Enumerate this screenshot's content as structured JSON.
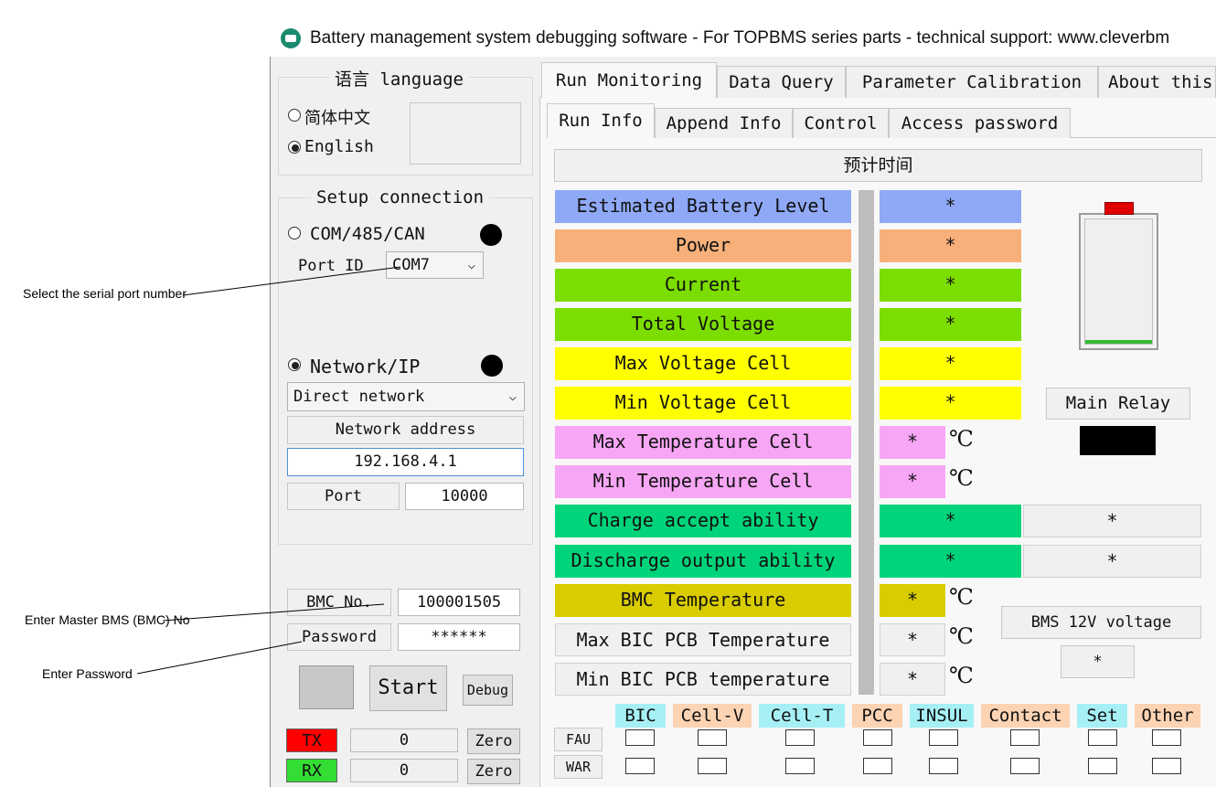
{
  "window": {
    "title": "Battery management system debugging software - For TOPBMS series parts - technical support: www.cleverbm"
  },
  "annotations": {
    "serial_port": "Select the serial port number",
    "master_bms": "Enter Master BMS (BMC) No",
    "password": "Enter Password"
  },
  "language": {
    "group_title": "语言 language",
    "option_cn": "简体中文",
    "option_en": "English"
  },
  "connection": {
    "group_title": "Setup connection",
    "com_label": "COM/485/CAN",
    "port_id_label": "Port ID",
    "port_id_value": "COM7",
    "network_label": "Network/IP",
    "network_type": "Direct network",
    "network_address_label": "Network address",
    "network_address_value": "192.168.4.1",
    "port_label": "Port",
    "port_value": "10000"
  },
  "login": {
    "bmc_label": "BMC No.",
    "bmc_value": "100001505",
    "password_label": "Password",
    "password_value": "******",
    "start": "Start",
    "debug": "Debug"
  },
  "traffic": {
    "tx_label": "TX",
    "tx_value": "0",
    "tx_zero": "Zero",
    "rx_label": "RX",
    "rx_value": "0",
    "rx_zero": "Zero"
  },
  "main_tabs": [
    "Run Monitoring",
    "Data Query",
    "Parameter Calibration",
    "About this"
  ],
  "sub_tabs": [
    "Run Info",
    "Append Info",
    "Control",
    "Access password"
  ],
  "estimated_time_label": "预计时间",
  "metrics": [
    {
      "label": "Estimated Battery Level",
      "value": "*",
      "unit": ""
    },
    {
      "label": "Power",
      "value": "*",
      "unit": ""
    },
    {
      "label": "Current",
      "value": "*",
      "unit": ""
    },
    {
      "label": "Total Voltage",
      "value": "*",
      "unit": ""
    },
    {
      "label": "Max Voltage Cell",
      "value": "*",
      "unit": ""
    },
    {
      "label": "Min Voltage Cell",
      "value": "*",
      "unit": ""
    },
    {
      "label": "Max Temperature Cell",
      "value": "*",
      "unit": "℃"
    },
    {
      "label": "Min Temperature Cell",
      "value": "*",
      "unit": "℃"
    },
    {
      "label": "Charge accept ability",
      "value": "*",
      "extra": "*"
    },
    {
      "label": "Discharge output ability",
      "value": "*",
      "extra": "*"
    },
    {
      "label": "BMC Temperature",
      "value": "*",
      "unit": "℃"
    },
    {
      "label": "Max BIC PCB Temperature",
      "value": "*",
      "unit": "℃"
    },
    {
      "label": "Min BIC PCB temperature",
      "value": "*",
      "unit": "℃"
    }
  ],
  "colors": {
    "battery": "#8fa9f7",
    "power": "#f8b07a",
    "green": "#7cdd00",
    "yellow": "#ffff00",
    "pink": "#f7a6f5",
    "teal": "#00d47a",
    "olive": "#d9cc00",
    "gray": "#f0f0f0",
    "tx": "#ff0000",
    "rx": "#33dd33"
  },
  "battery_indicator": {
    "level": 0.0
  },
  "main_relay": {
    "label": "Main Relay",
    "state": "off"
  },
  "bms12v": {
    "label": "BMS 12V voltage",
    "value": "*"
  },
  "alarm": {
    "categories": [
      "BIC",
      "Cell-V",
      "Cell-T",
      "PCC",
      "INSUL",
      "Contact",
      "Set",
      "Other"
    ],
    "category_colors": [
      "#a6f0f5",
      "#fcd3b3",
      "#a6f0f5",
      "#fcd3b3",
      "#a6f0f5",
      "#fcd3b3",
      "#a6f0f5",
      "#fcd3b3"
    ],
    "rows": [
      "FAU",
      "WAR"
    ]
  }
}
